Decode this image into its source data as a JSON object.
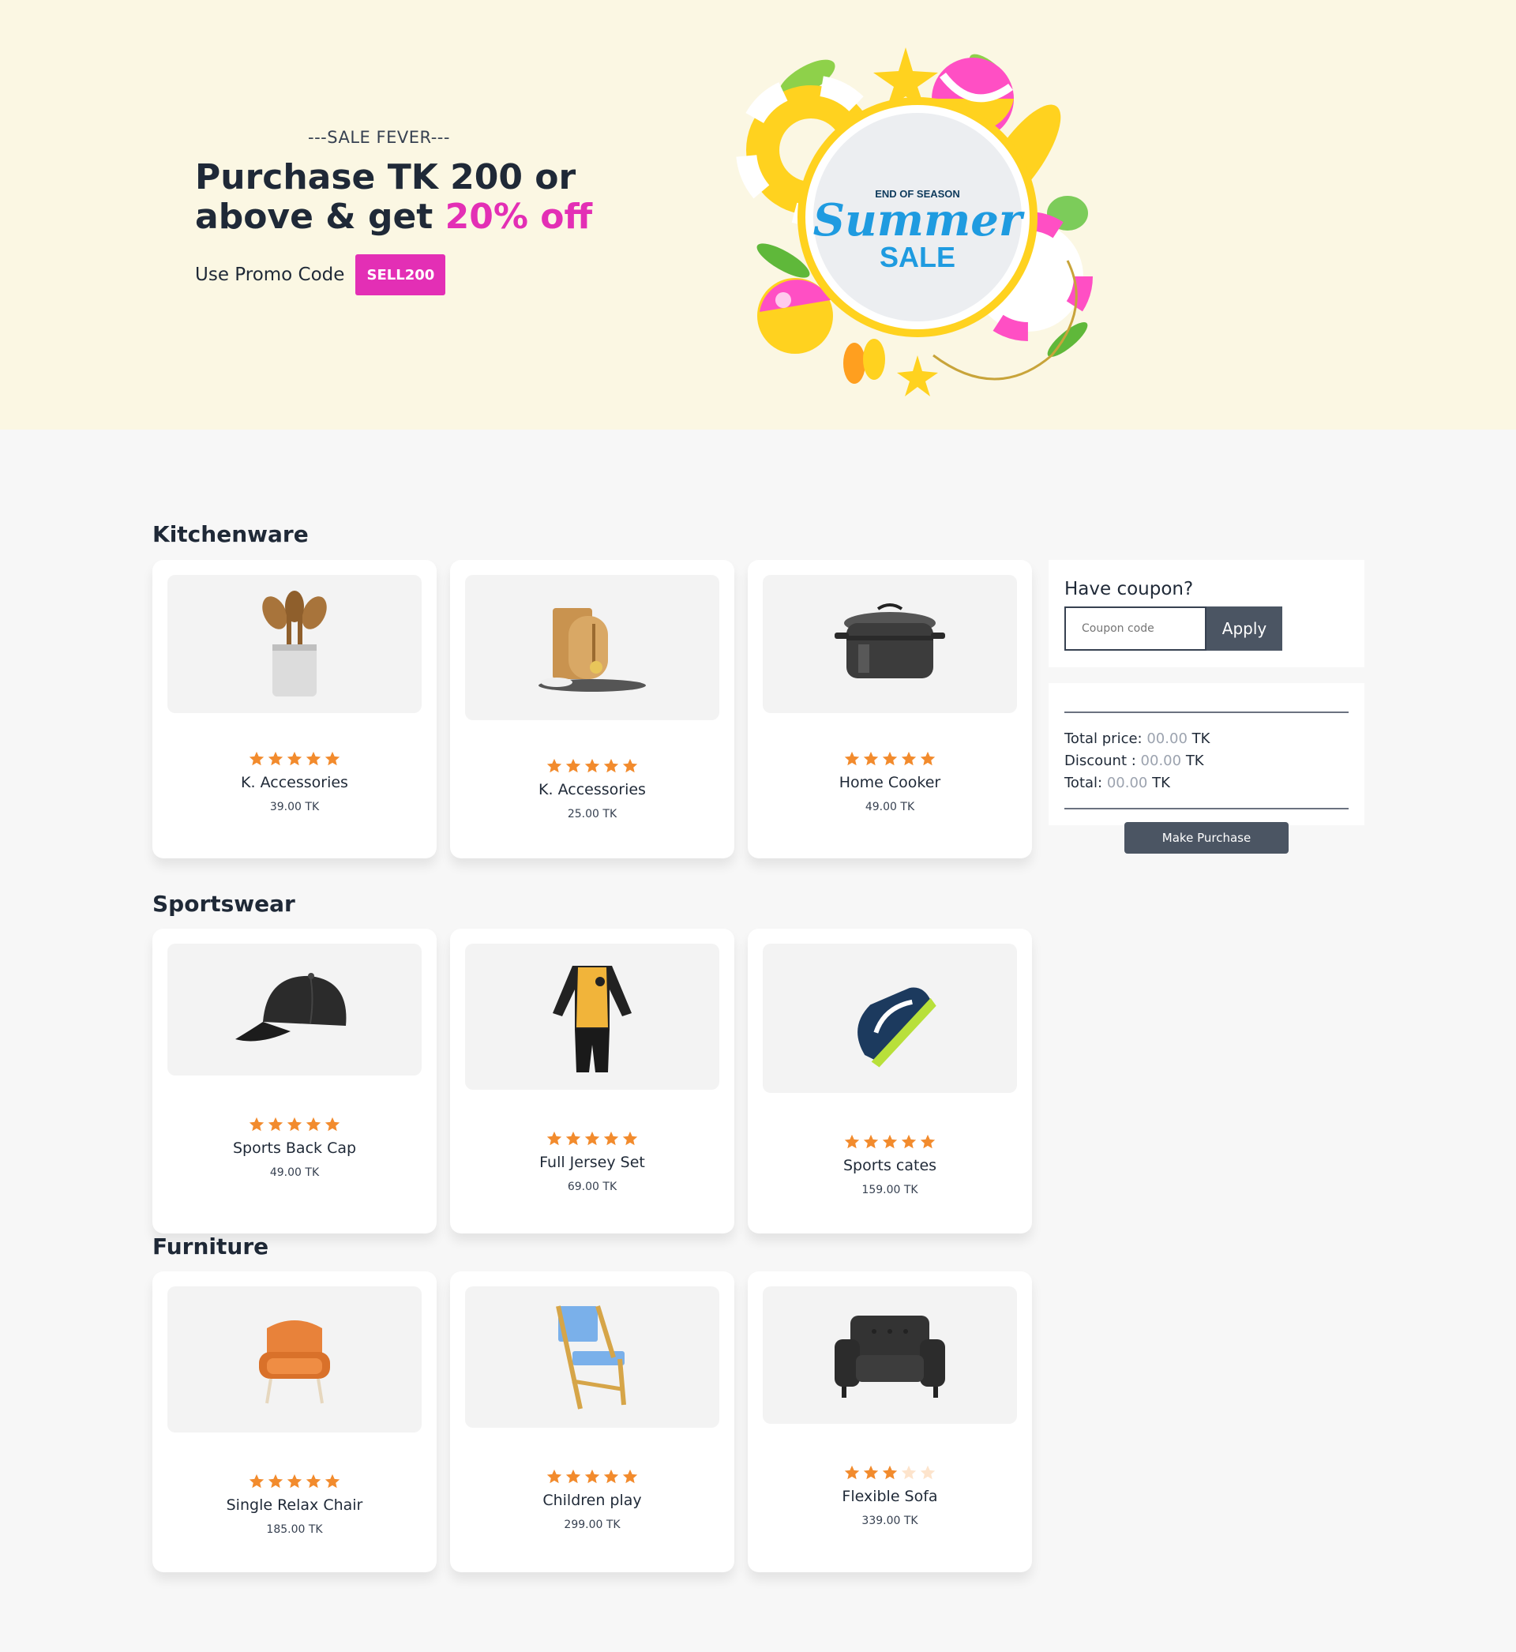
{
  "hero": {
    "tagline": "---SALE FEVER---",
    "headline_line1": "Purchase TK 200 or",
    "headline_line2_prefix": "above & get ",
    "headline_line2_accent": "20% off",
    "promo_label": "Use Promo Code",
    "promo_code": "SELL200",
    "badge_top": "END OF SEASON",
    "badge_script": "Summer",
    "badge_bottom": "SALE"
  },
  "sections": {
    "kitchenware": "Kitchenware",
    "sportswear": "Sportswear",
    "furniture": "Furniture"
  },
  "products": {
    "k1": {
      "name": "K. Accessories",
      "price": "39.00 TK",
      "rating": 5,
      "icon": "utensils-holder-icon"
    },
    "k2": {
      "name": "K. Accessories",
      "price": "25.00 TK",
      "rating": 5,
      "icon": "cutting-boards-icon"
    },
    "k3": {
      "name": "Home Cooker",
      "price": "49.00 TK",
      "rating": 5,
      "icon": "cooking-pot-icon"
    },
    "s1": {
      "name": "Sports Back Cap",
      "price": "49.00 TK",
      "rating": 5,
      "icon": "cap-icon"
    },
    "s2": {
      "name": "Full Jersey Set",
      "price": "69.00 TK",
      "rating": 5,
      "icon": "jersey-icon"
    },
    "s3": {
      "name": "Sports cates",
      "price": "159.00 TK",
      "rating": 5,
      "icon": "sneaker-icon"
    },
    "f1": {
      "name": "Single Relax Chair",
      "price": "185.00 TK",
      "rating": 5,
      "icon": "armchair-icon"
    },
    "f2": {
      "name": "Children play",
      "price": "299.00 TK",
      "rating": 5,
      "icon": "folding-chair-icon"
    },
    "f3": {
      "name": "Flexible Sofa",
      "price": "339.00 TK",
      "rating": 3,
      "icon": "sofa-icon"
    }
  },
  "coupon": {
    "title": "Have coupon?",
    "placeholder": "Coupon code",
    "apply_label": "Apply"
  },
  "totals": {
    "total_price_label": "Total price:",
    "total_price_value": "00.00",
    "discount_label": "Discount :",
    "discount_value": "00.00",
    "total_label": "Total:",
    "total_value": "00.00",
    "currency": "TK"
  },
  "purchase_label": "Make Purchase",
  "colors": {
    "accent": "#e32fb5",
    "hero_bg": "#fbf7e3",
    "star": "#f28b2d",
    "star_empty": "#fde4cc",
    "button": "#4b5563"
  }
}
